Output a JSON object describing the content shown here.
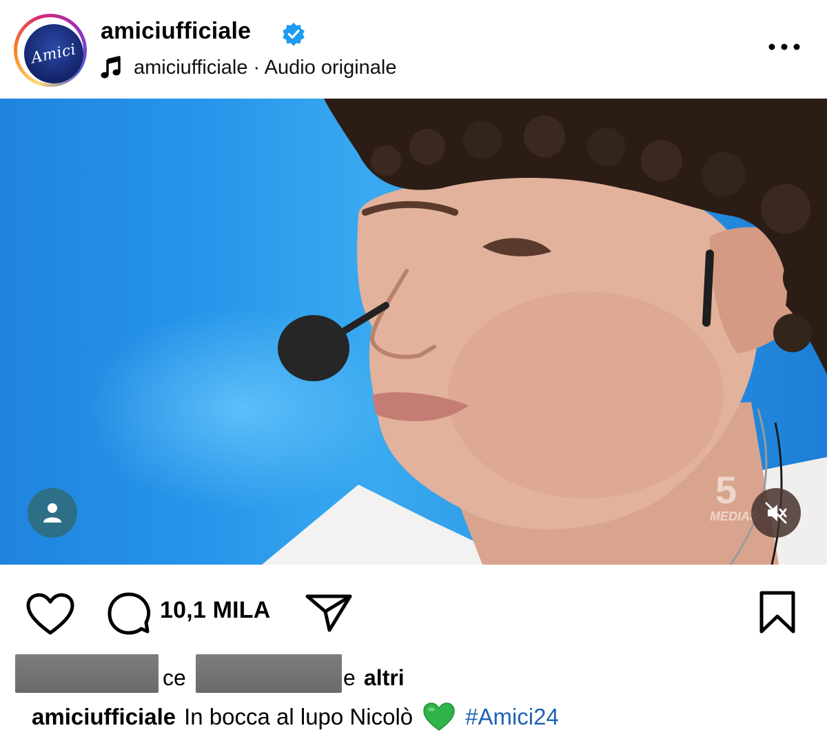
{
  "header": {
    "username": "amiciufficiale",
    "avatar_text": "Amici",
    "audio_label": "amiciufficiale · Audio originale",
    "icons": {
      "verified": "verified-badge-icon",
      "music": "music-note-icon",
      "more": "more-options-icon"
    }
  },
  "video": {
    "watermark_number": "5",
    "watermark_brand": "MEDIAS",
    "icons": {
      "user_tag": "person-icon",
      "mute": "speaker-muted-icon"
    }
  },
  "actions": {
    "comment_count": "10,1 MILA",
    "icons": {
      "like": "heart-icon",
      "comment": "comment-bubble-icon",
      "share": "paper-plane-icon",
      "save": "bookmark-icon"
    }
  },
  "likes": {
    "connector": "ce",
    "suffix": "e",
    "others": "altri"
  },
  "caption": {
    "username": "amiciufficiale",
    "text": "In bocca al lupo Nicolò",
    "emoji": "💚",
    "hashtag": "#Amici24"
  },
  "colors": {
    "accent_blue": "#1f62b5",
    "verified_blue": "#1d9bf0",
    "heart_green": "#2fb34a"
  }
}
